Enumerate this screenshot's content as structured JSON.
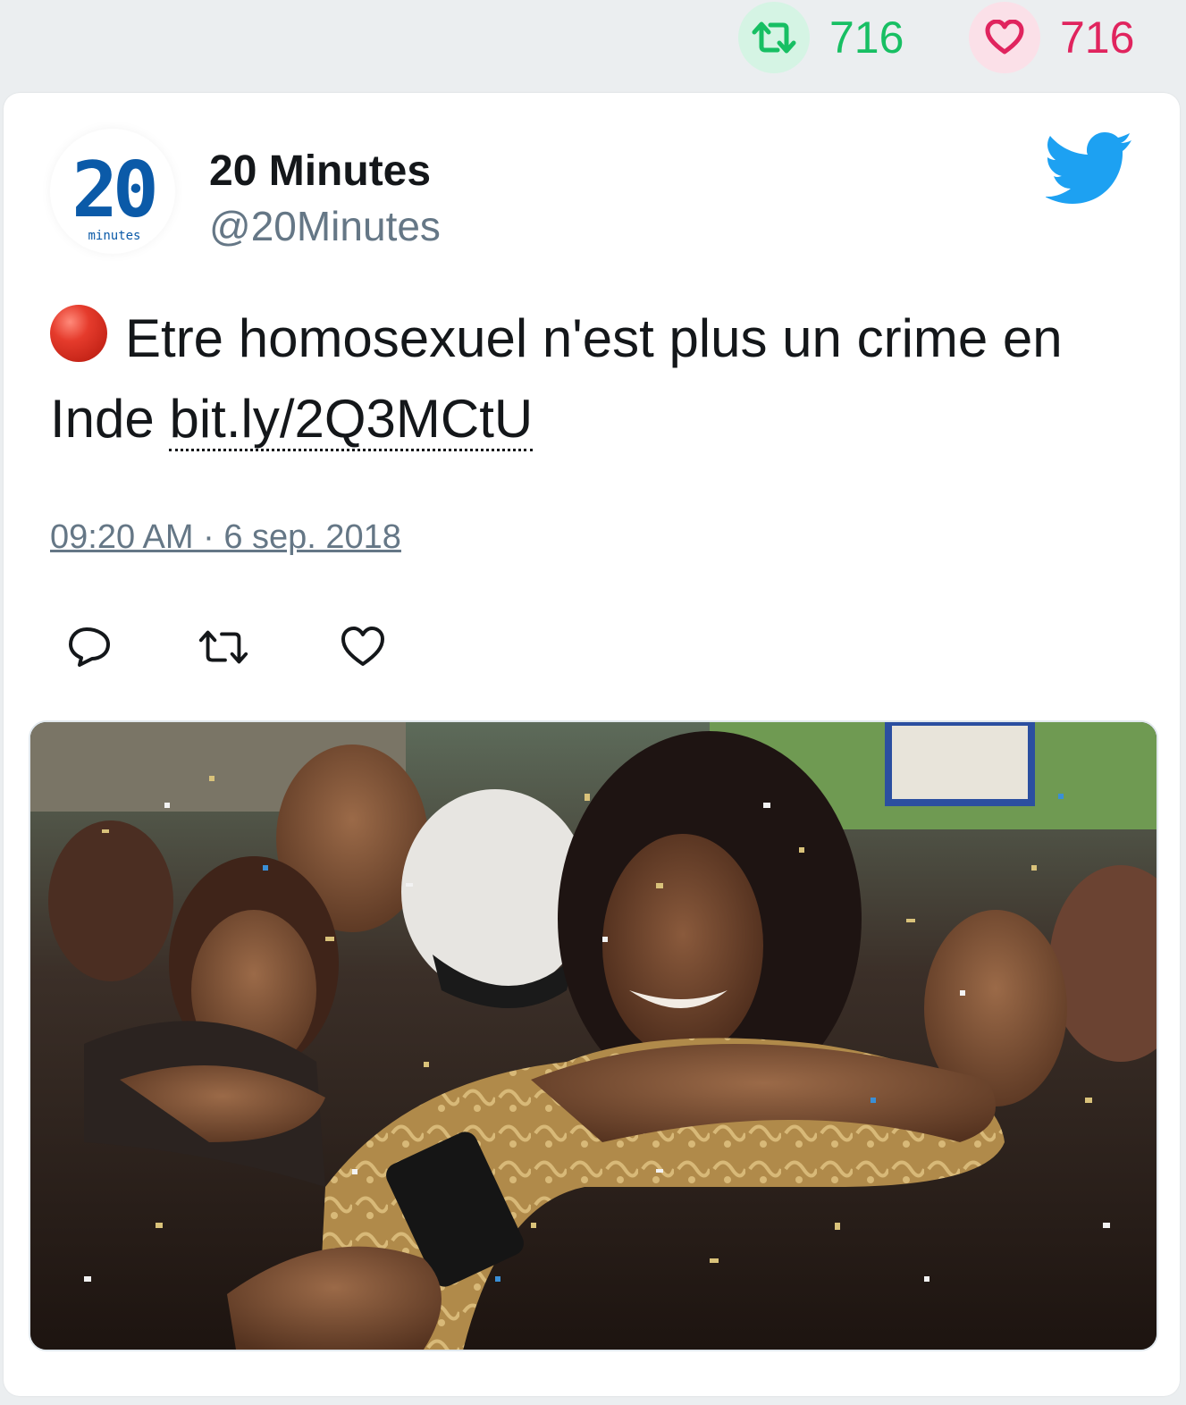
{
  "stats": {
    "retweet_count": "716",
    "like_count": "716"
  },
  "author": {
    "name": "20 Minutes",
    "handle": "@20Minutes",
    "avatar_text": "20",
    "avatar_subtext": "minutes"
  },
  "tweet": {
    "emoji": "red-circle",
    "text": "Etre homosexuel n'est plus un crime en Inde",
    "link_text": "bit.ly/2Q3MCtU",
    "timestamp": "09:20 AM · 6 sep. 2018"
  },
  "actions": [
    "reply-icon",
    "retweet-icon",
    "like-icon"
  ],
  "media": {
    "kind": "photo"
  },
  "colors": {
    "retweet_green": "#17bf63",
    "like_red": "#e0245e",
    "twitter_blue": "#1da1f2",
    "text": "#14171a",
    "muted": "#657786",
    "brand_20min_blue": "#0b5aa8"
  }
}
